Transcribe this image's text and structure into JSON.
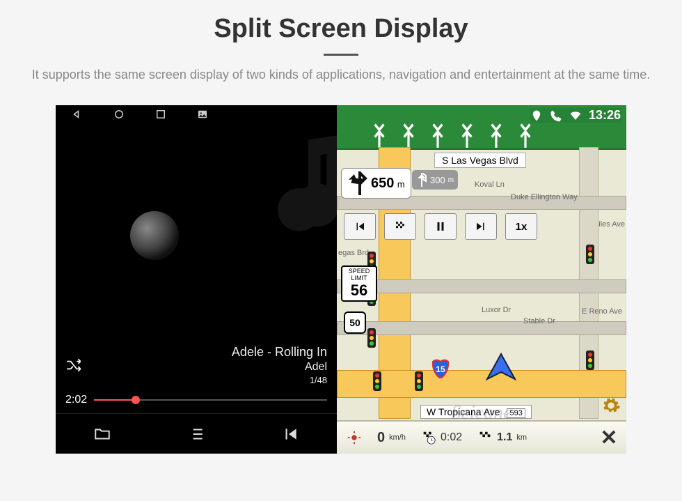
{
  "header": {
    "title": "Split Screen Display",
    "subtitle": "It supports the same screen display of two kinds of applications, navigation and entertainment at the same time."
  },
  "status": {
    "time": "13:26"
  },
  "music": {
    "track_line1": "Adele - Rolling In",
    "track_line2": "Adel",
    "track_counter": "1/48",
    "elapsed": "2:02"
  },
  "nav": {
    "top_street": "S Las Vegas Blvd",
    "turn_distance": "650",
    "turn_unit": "m",
    "next_distance": "300",
    "next_unit": "m",
    "speed_label_top": "SPEED",
    "speed_label_bottom": "LIMIT",
    "speed_value": "56",
    "route_shield": "50",
    "interstate": "15",
    "playback_speed": "1x",
    "bottom_street": "W Tropicana Ave",
    "bottom_street_num": "593",
    "labels": {
      "vegas_brd": "egas Brd",
      "iles": "iles Ave",
      "koval": "Koval Ln",
      "duke": "Duke Ellington Way",
      "luxor": "Luxor Dr",
      "stable": "Stable Dr",
      "reno": "E Reno Ave"
    },
    "bottombar": {
      "speed": "0",
      "speed_unit": "km/h",
      "eta": "0:02",
      "dist": "1.1",
      "dist_unit": "km"
    }
  },
  "watermark": "Seicane"
}
